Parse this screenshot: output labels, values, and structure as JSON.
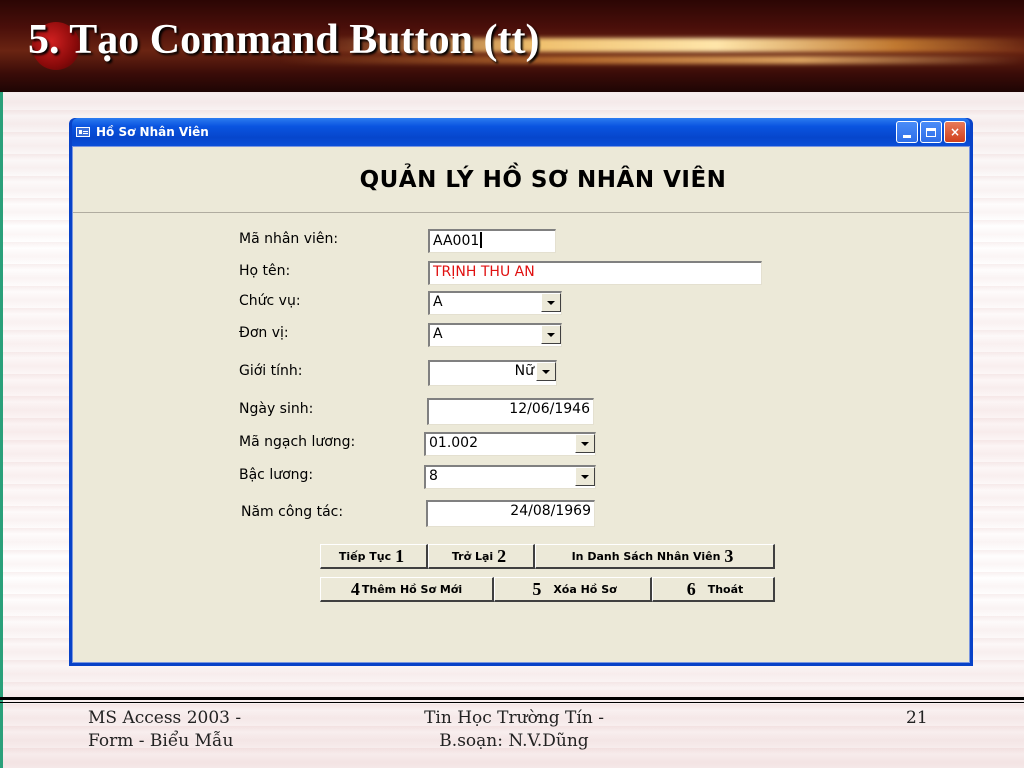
{
  "slide": {
    "title": "5. Tạo Command Button (tt)",
    "footer_left_line1": "MS Access 2003 -",
    "footer_left_line2": "Form - Biểu Mẫu",
    "footer_center_line1": "Tin Học Trường Tín -",
    "footer_center_line2": "B.soạn: N.V.Dũng",
    "page_number": "21"
  },
  "window": {
    "title": "Hồ Sơ Nhân Viên",
    "minimize_label": "minimize",
    "maximize_label": "maximize",
    "close_label": "×"
  },
  "form": {
    "heading": "QUẢN LÝ HỒ SƠ NHÂN VIÊN",
    "fields": {
      "ma_nhan_vien": {
        "label": "Mã nhân viên:",
        "value": "AA001"
      },
      "ho_ten": {
        "label": "Họ tên:",
        "value": "TRỊNH THU AN"
      },
      "chuc_vu": {
        "label": "Chức vụ:",
        "value": "A"
      },
      "don_vi": {
        "label": "Đơn vị:",
        "value": "A"
      },
      "gioi_tinh": {
        "label": "Giới tính:",
        "value": "Nữ"
      },
      "ngay_sinh": {
        "label": "Ngày sinh:",
        "value": "12/06/1946"
      },
      "ma_ngach_luong": {
        "label": "Mã ngạch lương:",
        "value": "01.002"
      },
      "bac_luong": {
        "label": "Bậc lương:",
        "value": "8"
      },
      "nam_cong_tac": {
        "label": "Năm công tác:",
        "value": "24/08/1969"
      }
    },
    "buttons": {
      "tiep_tuc": {
        "label": "Tiếp Tục",
        "num": "1"
      },
      "tro_lai": {
        "label": "Trở Lại",
        "num": "2"
      },
      "in_danh_sach": {
        "label": "In Danh Sách Nhân Viên",
        "num": "3"
      },
      "them_ho_so": {
        "label": "Thêm Hồ Sơ Mới",
        "num": "4"
      },
      "xoa_ho_so": {
        "label": "Xóa Hồ Sơ",
        "num": "5"
      },
      "thoat": {
        "label": "Thoát",
        "num": "6"
      }
    }
  }
}
